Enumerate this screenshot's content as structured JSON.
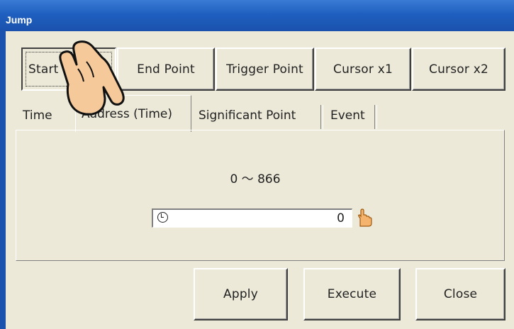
{
  "window": {
    "title": "Jump"
  },
  "jump_buttons": [
    "Start",
    "End Point",
    "Trigger Point",
    "Cursor x1",
    "Cursor x2"
  ],
  "tabs": [
    "Time",
    "Address (Time)",
    "Significant Point",
    "Event"
  ],
  "selected_tab": "Address (Time)",
  "range_text": "0 ～ 866",
  "address_field": {
    "value": "0"
  },
  "actions": {
    "apply": "Apply",
    "execute": "Execute",
    "close": "Close"
  },
  "icons": {
    "field_left": "clock-icon",
    "field_right": "hand-pointer-icon",
    "overlay": "pointing-hand-icon"
  },
  "colors": {
    "title_bar": "#1f5fbf",
    "window_bg": "#ece9d8",
    "hand_fill": "#f5c99a"
  }
}
